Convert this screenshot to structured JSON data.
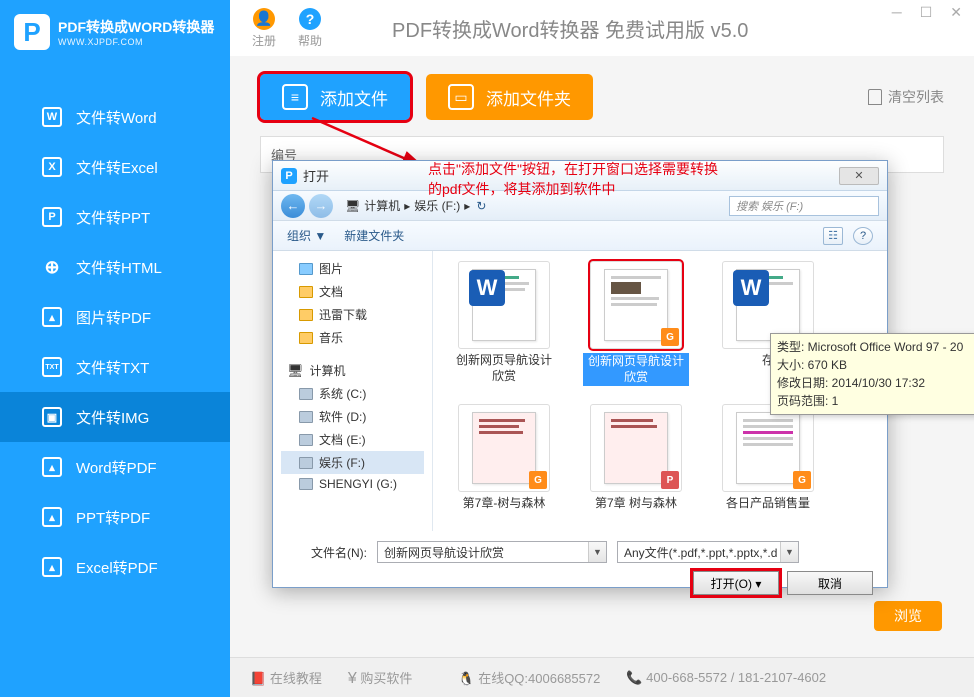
{
  "app": {
    "logo_text": "PDF转换成WORD转换器",
    "logo_sub": "WWW.XJPDF.COM",
    "title": "PDF转换成Word转换器 免费试用版 v5.0"
  },
  "topbar": {
    "register": "注册",
    "help": "帮助"
  },
  "sidebar": {
    "items": [
      {
        "icon": "W",
        "label": "文件转Word"
      },
      {
        "icon": "X",
        "label": "文件转Excel"
      },
      {
        "icon": "P",
        "label": "文件转PPT"
      },
      {
        "icon": "⊕",
        "label": "文件转HTML"
      },
      {
        "icon": "⬚",
        "label": "图片转PDF"
      },
      {
        "icon": "TXT",
        "label": "文件转TXT"
      },
      {
        "icon": "▣",
        "label": "文件转IMG"
      },
      {
        "icon": "⬚",
        "label": "Word转PDF"
      },
      {
        "icon": "⬚",
        "label": "PPT转PDF"
      },
      {
        "icon": "⬚",
        "label": "Excel转PDF"
      }
    ]
  },
  "actions": {
    "add_file": "添加文件",
    "add_folder": "添加文件夹",
    "clear": "清空列表"
  },
  "table": {
    "col0": "编号"
  },
  "annotation": {
    "line1": "点击\"添加文件\"按钮，在打开窗口选择需要转换",
    "line2": "的pdf文件，将其添加到软件中"
  },
  "dialog": {
    "title": "打开",
    "breadcrumb": {
      "a": "计算机",
      "b": "娱乐 (F:)"
    },
    "search_placeholder": "搜索 娱乐 (F:)",
    "organize": "组织 ▼",
    "new_folder": "新建文件夹",
    "tree": [
      {
        "label": "图片",
        "level": 2,
        "icon": "pic"
      },
      {
        "label": "文档",
        "level": 2,
        "icon": "folder"
      },
      {
        "label": "迅雷下载",
        "level": 2,
        "icon": "folder"
      },
      {
        "label": "音乐",
        "level": 2,
        "icon": "folder"
      },
      {
        "label": "计算机",
        "level": 1,
        "icon": "computer"
      },
      {
        "label": "系统 (C:)",
        "level": 2,
        "icon": "drive"
      },
      {
        "label": "软件 (D:)",
        "level": 2,
        "icon": "drive"
      },
      {
        "label": "文档 (E:)",
        "level": 2,
        "icon": "drive"
      },
      {
        "label": "娱乐 (F:)",
        "level": 2,
        "icon": "drive",
        "selected": true
      },
      {
        "label": "SHENGYI (G:)",
        "level": 2,
        "icon": "drive"
      }
    ],
    "files": [
      {
        "name": "创新网页导航设计欣赏",
        "type": "word"
      },
      {
        "name": "创新网页导航设计欣赏",
        "type": "pdf",
        "selected": true
      },
      {
        "name": "存",
        "type": "word"
      },
      {
        "name": "第7章-树与森林",
        "type": "pdf"
      },
      {
        "name": "第7章 树与森林",
        "type": "pdf"
      },
      {
        "name": "各日产品销售量",
        "type": "pdf"
      }
    ],
    "tooltip": {
      "l1": "类型: Microsoft Office Word 97 - 20",
      "l2": "大小: 670 KB",
      "l3": "修改日期: 2014/10/30 17:32",
      "l4": "页码范围: 1"
    },
    "filename_label": "文件名(N):",
    "filename_value": "创新网页导航设计欣赏",
    "filter": "Any文件(*.pdf,*.ppt,*.pptx,*.d",
    "open": "打开(O)",
    "cancel": "取消"
  },
  "browse": "浏览",
  "footer": {
    "tutorial": "在线教程",
    "buy": "购买软件",
    "qq": "在线QQ:4006685572",
    "phone": "400-668-5572 / 181-2107-4602"
  }
}
